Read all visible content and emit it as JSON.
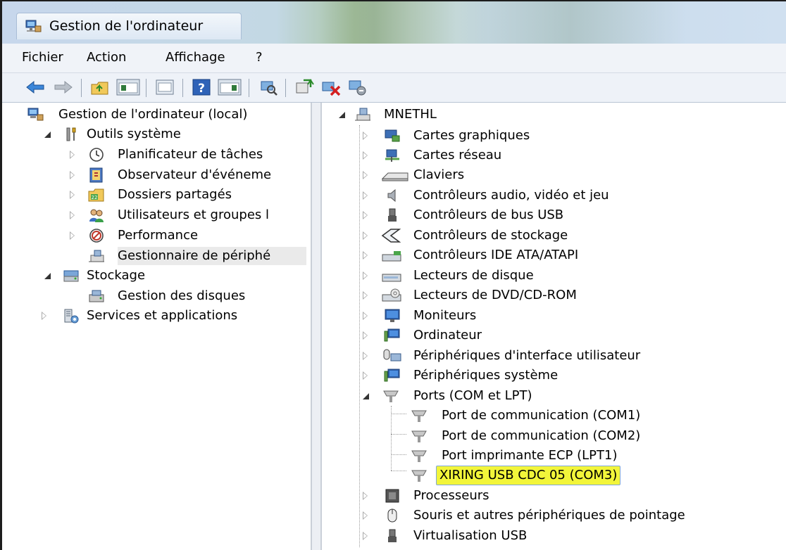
{
  "window": {
    "title": "Gestion de l'ordinateur"
  },
  "menu": [
    "Fichier",
    "Action",
    "Affichage",
    "?"
  ],
  "toolbar": {
    "buttons": [
      "back-arrow-icon",
      "forward-arrow-icon",
      "up-folder-icon",
      "show-hide-console-tree-icon",
      "export-list-icon",
      "help-icon",
      "show-hide-action-pane-icon",
      "scan-hardware-icon",
      "update-driver-icon",
      "uninstall-device-icon",
      "disable-device-icon"
    ]
  },
  "left_tree": {
    "root": "Gestion de l'ordinateur (local)",
    "items": [
      {
        "label": "Outils système",
        "level": 1,
        "expanded": true
      },
      {
        "label": "Planificateur de tâches",
        "level": 2
      },
      {
        "label": "Observateur d'événeme",
        "level": 2
      },
      {
        "label": "Dossiers partagés",
        "level": 2
      },
      {
        "label": "Utilisateurs et groupes l",
        "level": 2
      },
      {
        "label": "Performance",
        "level": 2
      },
      {
        "label": "Gestionnaire de périphé",
        "level": 2,
        "selected": true
      },
      {
        "label": "Stockage",
        "level": 1,
        "expanded": true
      },
      {
        "label": "Gestion des disques",
        "level": 2
      },
      {
        "label": "Services et applications",
        "level": 1
      }
    ]
  },
  "device_tree": {
    "root": "MNETHL",
    "categories": [
      "Cartes graphiques",
      "Cartes réseau",
      "Claviers",
      "Contrôleurs audio, vidéo et jeu",
      "Contrôleurs de bus USB",
      "Contrôleurs de stockage",
      "Contrôleurs IDE ATA/ATAPI",
      "Lecteurs de disque",
      "Lecteurs de DVD/CD-ROM",
      "Moniteurs",
      "Ordinateur",
      "Périphériques d'interface utilisateur",
      "Périphériques système",
      "Ports (COM et LPT)"
    ],
    "ports": [
      "Port de communication (COM1)",
      "Port de communication (COM2)",
      "Port imprimante ECP (LPT1)",
      "XIRING USB CDC 05 (COM3)"
    ],
    "after_ports": [
      "Processeurs",
      "Souris et autres périphériques de pointage",
      "Virtualisation USB"
    ]
  },
  "colors": {
    "highlight": "#f2f53a",
    "selection_border": "#7fa6d9"
  }
}
